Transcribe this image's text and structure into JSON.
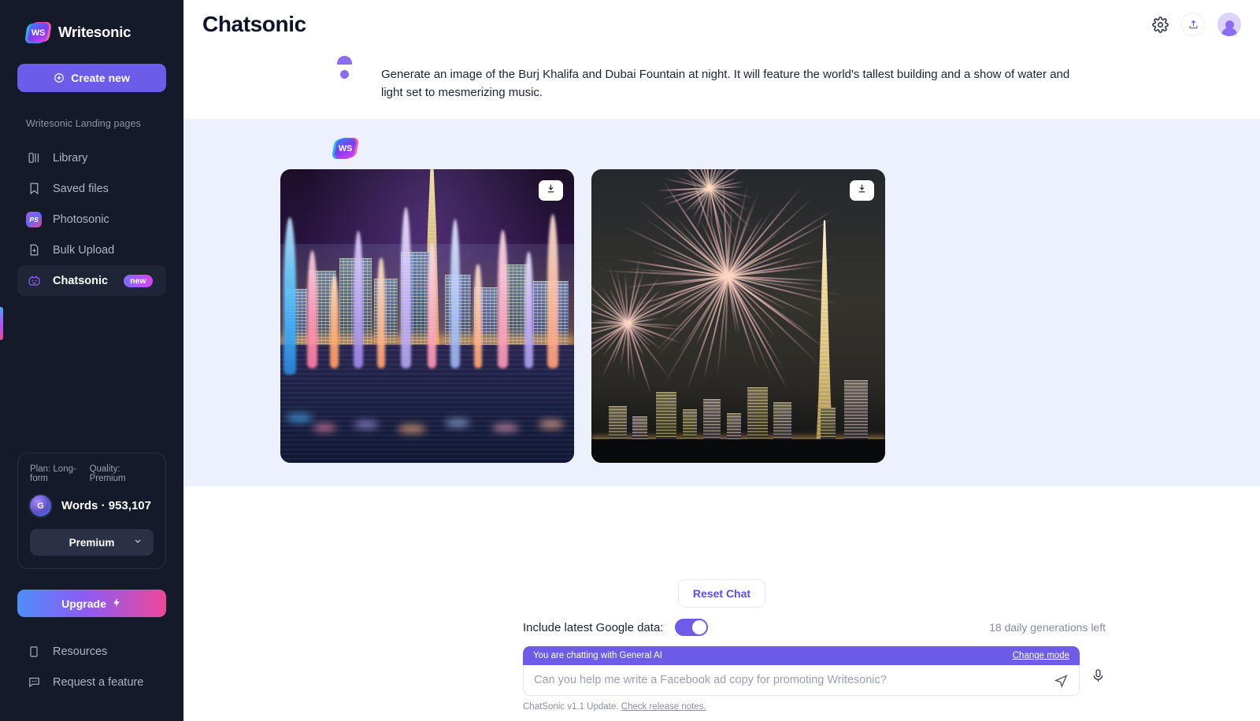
{
  "sidebar": {
    "brand": {
      "name": "Writesonic",
      "logo_text": "WS"
    },
    "create_new": {
      "label": "Create new",
      "icon": "plus-circle-icon"
    },
    "section_label": "Writesonic Landing pages",
    "items": [
      {
        "label": "Library",
        "icon": "library-icon",
        "active": false
      },
      {
        "label": "Saved files",
        "icon": "bookmark-icon",
        "active": false
      },
      {
        "label": "Photosonic",
        "icon": "photosonic-icon",
        "badge_text": "PS",
        "active": false
      },
      {
        "label": "Bulk Upload",
        "icon": "file-plus-icon",
        "active": false
      },
      {
        "label": "Chatsonic",
        "icon": "robot-icon",
        "active": true,
        "pill": "new"
      }
    ],
    "plan_card": {
      "plan": "Plan: Long-form",
      "quality": "Quality: Premium",
      "orb_letter": "G",
      "words_label": "Words",
      "separator": "·",
      "words_value": "953,107",
      "select_value": "Premium"
    },
    "upgrade": {
      "label": "Upgrade",
      "icon": "lightning-icon"
    },
    "bottom_items": [
      {
        "label": "Resources",
        "icon": "book-icon"
      },
      {
        "label": "Request a feature",
        "icon": "chat-bubble-icon"
      }
    ]
  },
  "topbar": {
    "title": "Chatsonic",
    "settings_icon": "gear-icon",
    "share_icon": "share-upload-icon",
    "avatar_icon": "user-avatar-icon"
  },
  "conversation": {
    "user_message": {
      "avatar": "user-avatar-icon",
      "text": "Generate an image of the Burj Khalifa and Dubai Fountain at night. It will feature the world's tallest building and a show of water and light set to mesmerizing music."
    },
    "bot_message": {
      "avatar": "writesonic-logo-icon",
      "images": [
        {
          "alt": "Dubai Fountain water show lit in color at night with Burj Khalifa",
          "download_icon": "download-icon"
        },
        {
          "alt": "Fireworks bursting over the Burj Khalifa and Dubai skyline at night",
          "download_icon": "download-icon"
        }
      ]
    }
  },
  "composer": {
    "reset_label": "Reset Chat",
    "google_toggle_label": "Include latest Google data:",
    "google_toggle_on": true,
    "generations_left": "18 daily generations left",
    "mode_text": "You are chatting with General AI",
    "change_mode_label": "Change mode",
    "input_value": "",
    "input_placeholder": "Can you help me write a Facebook ad copy for promoting Writesonic?",
    "send_icon": "send-icon",
    "mic_icon": "microphone-icon",
    "footer_text": "ChatSonic v1.1 Update.",
    "footer_link": "Check release notes."
  },
  "colors": {
    "sidebar_bg": "#141a2a",
    "accent_purple": "#6c5ce7",
    "bot_message_bg": "#edf0fd",
    "link_purple": "#5b4df0"
  }
}
